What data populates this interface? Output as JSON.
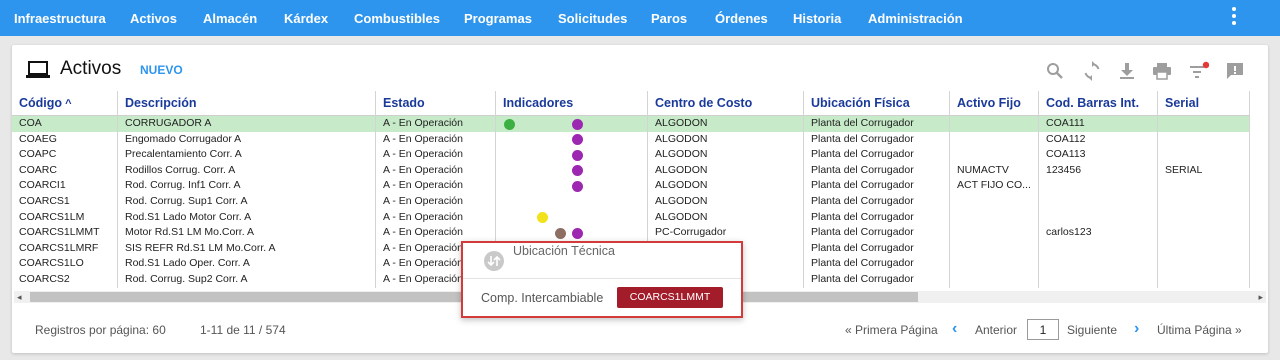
{
  "nav": {
    "items": [
      "Infraestructura",
      "Activos",
      "Almacén",
      "Kárdex",
      "Combustibles",
      "Programas",
      "Solicitudes",
      "Paros",
      "Órdenes",
      "Historia",
      "Administración"
    ],
    "menu_icon": "more-vertical-icon"
  },
  "header": {
    "title": "Activos",
    "title_icon": "laptop-icon",
    "new_label": "NUEVO",
    "toolbar_icons": [
      "search-icon",
      "refresh-icon",
      "download-icon",
      "print-icon",
      "filter-icon",
      "feedback-icon"
    ]
  },
  "table": {
    "columns": [
      "Código",
      "Descripción",
      "Estado",
      "Indicadores",
      "Centro de Costo",
      "Ubicación Física",
      "Activo Fijo",
      "Cod. Barras Int.",
      "Serial"
    ],
    "sort_column": "Código",
    "sort_direction": "asc",
    "rows": [
      {
        "codigo": "COA",
        "descripcion": "CORRUGADOR A",
        "estado": "A - En Operación",
        "indicadores": [
          "green",
          "purple"
        ],
        "centro": "ALGODON",
        "ubicacion": "Planta del Corrugador",
        "activo_fijo": "",
        "barras": "COA111",
        "serial": ""
      },
      {
        "codigo": "COAEG",
        "descripcion": "Engomado Corrugador A",
        "estado": "A - En Operación",
        "indicadores": [
          "purple"
        ],
        "centro": "ALGODON",
        "ubicacion": "Planta del Corrugador",
        "activo_fijo": "",
        "barras": "COA112",
        "serial": ""
      },
      {
        "codigo": "COAPC",
        "descripcion": "Precalentamiento Corr. A",
        "estado": "A - En Operación",
        "indicadores": [
          "purple"
        ],
        "centro": "ALGODON",
        "ubicacion": "Planta del Corrugador",
        "activo_fijo": "",
        "barras": "COA113",
        "serial": ""
      },
      {
        "codigo": "COARC",
        "descripcion": "Rodillos Corrug. Corr. A",
        "estado": "A - En Operación",
        "indicadores": [
          "purple"
        ],
        "centro": "ALGODON",
        "ubicacion": "Planta del Corrugador",
        "activo_fijo": "NUMACTV",
        "barras": "123456",
        "serial": "SERIAL"
      },
      {
        "codigo": "COARCI1",
        "descripcion": "Rod. Corrug. Inf1 Corr. A",
        "estado": "A - En Operación",
        "indicadores": [
          "purple"
        ],
        "centro": "ALGODON",
        "ubicacion": "Planta del Corrugador",
        "activo_fijo": "ACT FIJO CO...",
        "barras": "",
        "serial": ""
      },
      {
        "codigo": "COARCS1",
        "descripcion": "Rod. Corrug. Sup1 Corr. A",
        "estado": "A - En Operación",
        "indicadores": [],
        "centro": "ALGODON",
        "ubicacion": "Planta del Corrugador",
        "activo_fijo": "",
        "barras": "",
        "serial": ""
      },
      {
        "codigo": "COARCS1LM",
        "descripcion": "Rod.S1 Lado Motor Corr. A",
        "estado": "A - En Operación",
        "indicadores": [
          "yellow"
        ],
        "centro": "ALGODON",
        "ubicacion": "Planta del Corrugador",
        "activo_fijo": "",
        "barras": "",
        "serial": ""
      },
      {
        "codigo": "COARCS1LMMT",
        "descripcion": "Motor Rd.S1 LM Mo.Corr. A",
        "estado": "A - En Operación",
        "indicadores": [
          "brown",
          "purple"
        ],
        "centro": "PC-Corrugador",
        "ubicacion": "Planta del Corrugador",
        "activo_fijo": "",
        "barras": "carlos123",
        "serial": ""
      },
      {
        "codigo": "COARCS1LMRF",
        "descripcion": "SIS REFR Rd.S1 LM Mo.Corr. A",
        "estado": "A - En Operación",
        "indicadores": [],
        "centro": "",
        "ubicacion": "Planta del Corrugador",
        "activo_fijo": "",
        "barras": "",
        "serial": ""
      },
      {
        "codigo": "COARCS1LO",
        "descripcion": "Rod.S1 Lado Oper. Corr. A",
        "estado": "A - En Operación",
        "indicadores": [],
        "centro": "",
        "ubicacion": "Planta del Corrugador",
        "activo_fijo": "",
        "barras": "",
        "serial": ""
      },
      {
        "codigo": "COARCS2",
        "descripcion": "Rod. Corrug. Sup2 Corr. A",
        "estado": "A - En Operación",
        "indicadores": [],
        "centro": "",
        "ubicacion": "Planta del Corrugador",
        "activo_fijo": "",
        "barras": "",
        "serial": ""
      }
    ],
    "selected_row": 0
  },
  "indicator_colors": {
    "green": "#3cb043",
    "purple": "#9c27b0",
    "yellow": "#f2e21b",
    "brown": "#8d6e63"
  },
  "footer": {
    "per_page_label": "Registros por página:",
    "per_page_value": "60",
    "range": "1-11 de 11 / 574",
    "first_page": "« Primera Página",
    "prev": "Anterior",
    "page": "1",
    "next": "Siguiente",
    "last_page": "Última Página »"
  },
  "popup": {
    "title": "Ubicación Técnica",
    "label": "Comp. Intercambiable",
    "value": "COARCS1LMMT"
  },
  "colors": {
    "nav": "#2e95ee",
    "accent": "#2e95ee",
    "header_text": "#1a3a9a",
    "selected_row": "#c7eac9",
    "chip": "#a31c2a",
    "popup_border": "#d33b3b"
  }
}
